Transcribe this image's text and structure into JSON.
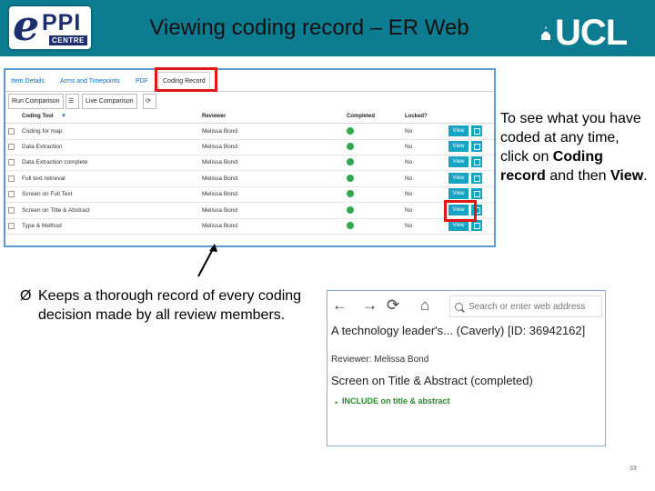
{
  "header": {
    "title": "Viewing coding record – ER Web",
    "logo_text": "PPI",
    "logo_sub": "CENTRE",
    "logo_e": "e",
    "university": "UCL"
  },
  "er_tabs": {
    "items": [
      "Item Details",
      "Arms and Timepoints",
      "PDF",
      "Coding Record"
    ],
    "active": "Coding Record"
  },
  "sub_tabs": [
    "Run Comparison",
    "Live Comparison"
  ],
  "grid": {
    "columns": [
      "Coding Tool",
      "Reviewer",
      "Completed",
      "Locked?"
    ],
    "rows": [
      {
        "tool": "Coding for map",
        "reviewer": "Melissa Bond",
        "locked": "No",
        "action": "View"
      },
      {
        "tool": "Data Extraction",
        "reviewer": "Melissa Bond",
        "locked": "No",
        "action": "View"
      },
      {
        "tool": "Data Extraction complete",
        "reviewer": "Melissa Bond",
        "locked": "No",
        "action": "View"
      },
      {
        "tool": "Full text retrieval",
        "reviewer": "Melissa Bond",
        "locked": "No",
        "action": "View"
      },
      {
        "tool": "Screen on Full Text",
        "reviewer": "Melissa Bond",
        "locked": "No",
        "action": "View"
      },
      {
        "tool": "Screen on Title & Abstract",
        "reviewer": "Melissa Bond",
        "locked": "No",
        "action": "View"
      },
      {
        "tool": "Type & Method",
        "reviewer": "Melissa Bond",
        "locked": "No",
        "action": "View"
      }
    ]
  },
  "callout": {
    "part1": "To see what you have coded at any time, click on ",
    "bold1": "Coding record",
    "part2": " and then ",
    "bold2": "View",
    "part3": "."
  },
  "bullet": {
    "mark": "Ø",
    "text": "Keeps a thorough record of every coding decision made by all review members."
  },
  "browser": {
    "address_placeholder": "Search or enter web address",
    "title": "A technology leader's... (Caverly) [ID: 36942162]",
    "reviewer": "Reviewer: Melissa Bond",
    "record": "Screen on Title & Abstract (completed)",
    "include_dot": "•",
    "include": "INCLUDE on title & abstract"
  },
  "page_number": "33",
  "colors": {
    "header_bg": "#0c7d91",
    "highlight": "#e01818",
    "view_button": "#16a3c4",
    "completed": "#2fa84f"
  }
}
